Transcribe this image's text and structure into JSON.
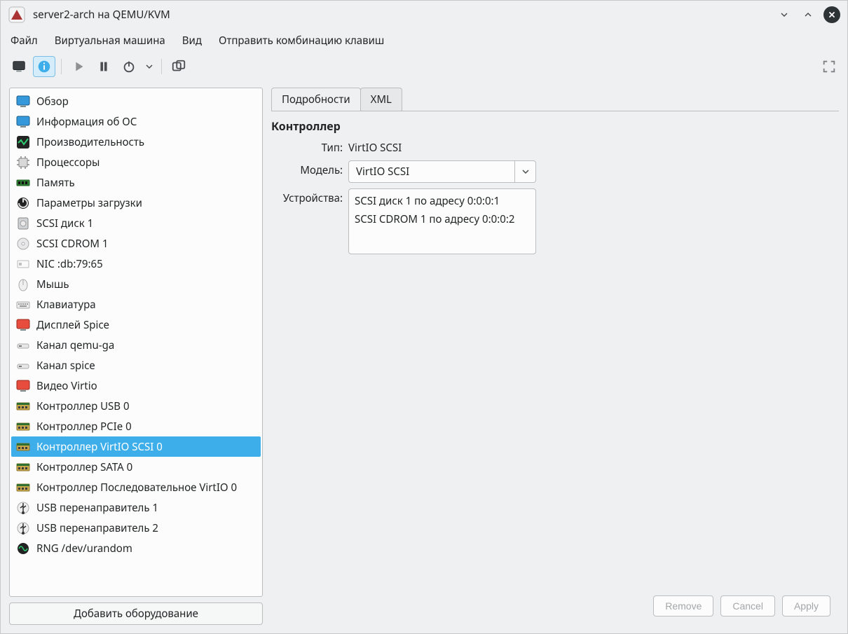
{
  "window": {
    "title": "server2-arch на QEMU/KVM"
  },
  "menubar": {
    "items": [
      "Файл",
      "Виртуальная машина",
      "Вид",
      "Отправить комбинацию клавиш"
    ]
  },
  "toolbar": {
    "console_tip": "Консоль",
    "info_tip": "Информация",
    "run_tip": "Запустить",
    "pause_tip": "Пауза",
    "shutdown_tip": "Выключить",
    "snapshots_tip": "Снимки",
    "fullscreen_tip": "Полный экран"
  },
  "sidebar": {
    "items": [
      {
        "label": "Обзор",
        "icon": "display-blue"
      },
      {
        "label": "Информация об ОС",
        "icon": "display-blue"
      },
      {
        "label": "Производительность",
        "icon": "perf"
      },
      {
        "label": "Процессоры",
        "icon": "cpu"
      },
      {
        "label": "Память",
        "icon": "ram"
      },
      {
        "label": "Параметры загрузки",
        "icon": "boot"
      },
      {
        "label": "SCSI диск 1",
        "icon": "disk"
      },
      {
        "label": "SCSI CDROM 1",
        "icon": "cdrom"
      },
      {
        "label": "NIC :db:79:65",
        "icon": "nic"
      },
      {
        "label": "Мышь",
        "icon": "mouse"
      },
      {
        "label": "Клавиатура",
        "icon": "keyboard"
      },
      {
        "label": "Дисплей Spice",
        "icon": "display-red"
      },
      {
        "label": "Канал qemu-ga",
        "icon": "channel"
      },
      {
        "label": "Канал spice",
        "icon": "channel"
      },
      {
        "label": "Видео Virtio",
        "icon": "display-red"
      },
      {
        "label": "Контроллер USB 0",
        "icon": "controller"
      },
      {
        "label": "Контроллер PCIe 0",
        "icon": "controller"
      },
      {
        "label": "Контроллер VirtIO SCSI 0",
        "icon": "controller",
        "selected": true
      },
      {
        "label": "Контроллер SATA 0",
        "icon": "controller"
      },
      {
        "label": "Контроллер Последовательное VirtIO 0",
        "icon": "controller"
      },
      {
        "label": "USB перенаправитель 1",
        "icon": "usb"
      },
      {
        "label": "USB перенаправитель 2",
        "icon": "usb"
      },
      {
        "label": "RNG /dev/urandom",
        "icon": "rng"
      }
    ],
    "add_hw_label": "Добавить оборудование"
  },
  "content": {
    "tabs": {
      "details": "Подробности",
      "xml": "XML"
    },
    "section_heading": "Контроллер",
    "type_label": "Тип:",
    "type_value": "VirtIO SCSI",
    "model_label": "Модель:",
    "model_value": "VirtIO SCSI",
    "devices_label": "Устройства:",
    "devices": [
      "SCSI диск 1 по адресу 0:0:0:1",
      "SCSI CDROM 1 по адресу 0:0:0:2"
    ]
  },
  "footer": {
    "remove": "Remove",
    "cancel": "Cancel",
    "apply": "Apply"
  }
}
